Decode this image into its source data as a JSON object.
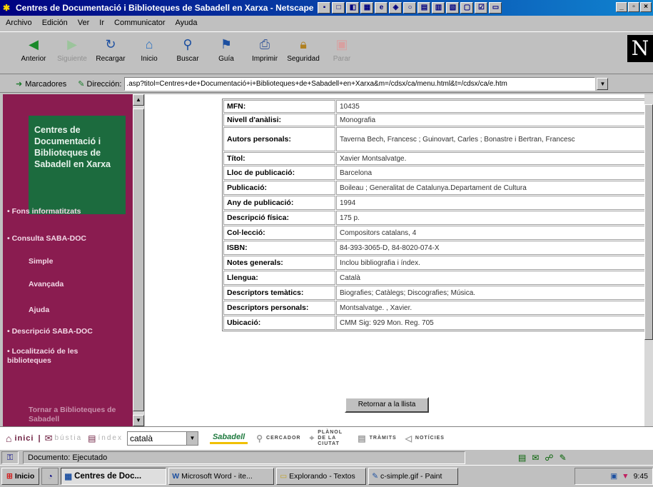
{
  "window": {
    "title": "Centres de Documentació i Biblioteques de Sabadell en Xarxa - Netscape",
    "controls": [
      "_",
      "▫",
      "×"
    ]
  },
  "menubar": [
    "Archivo",
    "Edición",
    "Ver",
    "Ir",
    "Communicator",
    "Ayuda"
  ],
  "toolbar": [
    {
      "label": "Anterior",
      "icon": "back-arrow-icon",
      "enabled": true
    },
    {
      "label": "Siguiente",
      "icon": "forward-arrow-icon",
      "enabled": false
    },
    {
      "label": "Recargar",
      "icon": "reload-icon",
      "enabled": true
    },
    {
      "label": "Inicio",
      "icon": "home-icon",
      "enabled": true
    },
    {
      "label": "Buscar",
      "icon": "search-icon",
      "enabled": true
    },
    {
      "label": "Guía",
      "icon": "guide-icon",
      "enabled": true
    },
    {
      "label": "Imprimir",
      "icon": "print-icon",
      "enabled": true
    },
    {
      "label": "Seguridad",
      "icon": "lock-icon",
      "enabled": true
    },
    {
      "label": "Parar",
      "icon": "stop-icon",
      "enabled": false
    }
  ],
  "location": {
    "bookmarks_label": "Marcadores",
    "address_label": "Dirección:",
    "url": ".asp?titol=Centres+de+Documentació+i+Biblioteques+de+Sabadell+en+Xarxa&m=/cdsx/ca/menu.html&t=/cdsx/ca/e.htm"
  },
  "sidebar": {
    "logo_text": "Centres de Documentació i Biblioteques de Sabadell en Xarxa",
    "items": [
      {
        "label": "Fons informatitzats",
        "bullet": true
      },
      {
        "label": "Consulta SABA-DOC",
        "bullet": true
      },
      {
        "label": "Simple",
        "bullet": false
      },
      {
        "label": "Avançada",
        "bullet": false
      },
      {
        "label": "Ajuda",
        "bullet": false
      },
      {
        "label": "Descripció SABA-DOC",
        "bullet": true
      },
      {
        "label": "Localització de les biblioteques",
        "bullet": true
      },
      {
        "label": "Tornar a Biblioteques de Sabadell",
        "bullet": false
      }
    ]
  },
  "record": {
    "rows": [
      {
        "key": "MFN:",
        "value": "10435"
      },
      {
        "key": "Nivell d'anàlisi:",
        "value": "Monografia"
      },
      {
        "key": "Autors personals:",
        "value": "Taverna Bech, Francesc ; Guinovart, Carles ; Bonastre i Bertran, Francesc"
      },
      {
        "key": "Títol:",
        "value": "Xavier Montsalvatge."
      },
      {
        "key": "Lloc de publicació:",
        "value": "Barcelona"
      },
      {
        "key": "Publicació:",
        "value": "Boileau ; Generalitat de Catalunya.Departament de Cultura"
      },
      {
        "key": "Any de publicació:",
        "value": "1994"
      },
      {
        "key": "Descripció física:",
        "value": "175 p."
      },
      {
        "key": "Col·lecció:",
        "value": "Compositors catalans, 4"
      },
      {
        "key": "ISBN:",
        "value": "84-393-3065-D, 84-8020-074-X"
      },
      {
        "key": "Notes generals:",
        "value": "Inclou bibliografia i índex."
      },
      {
        "key": "Llengua:",
        "value": "Català"
      },
      {
        "key": "Descriptors temàtics:",
        "value": "Biografies; Catàlegs; Discografies; Música."
      },
      {
        "key": "Descriptors personals:",
        "value": "Montsalvatge. , Xavier."
      },
      {
        "key": "Ubicació:",
        "value": "CMM Sig: 929 Mon. Reg. 705"
      }
    ],
    "return_button": "Retornar a la llista"
  },
  "bottom_nav": {
    "inici": "inici",
    "bustia": "bústia",
    "index": "índex",
    "language": "català",
    "sabadell": "Sabadell",
    "links": [
      "CERCADOR",
      "PLÀNOL DE LA CIUTAT",
      "TRÀMITS",
      "NOTÍCIES"
    ]
  },
  "status": {
    "text": "Documento: Ejecutado"
  },
  "taskbar": {
    "start": "Inicio",
    "tasks": [
      {
        "label": "Centres de Doc...",
        "active": true
      },
      {
        "label": "Microsoft Word - ite...",
        "active": false
      },
      {
        "label": "Explorando - Textos",
        "active": false
      },
      {
        "label": "c-simple.gif - Paint",
        "active": false
      }
    ],
    "clock": "9:45"
  }
}
